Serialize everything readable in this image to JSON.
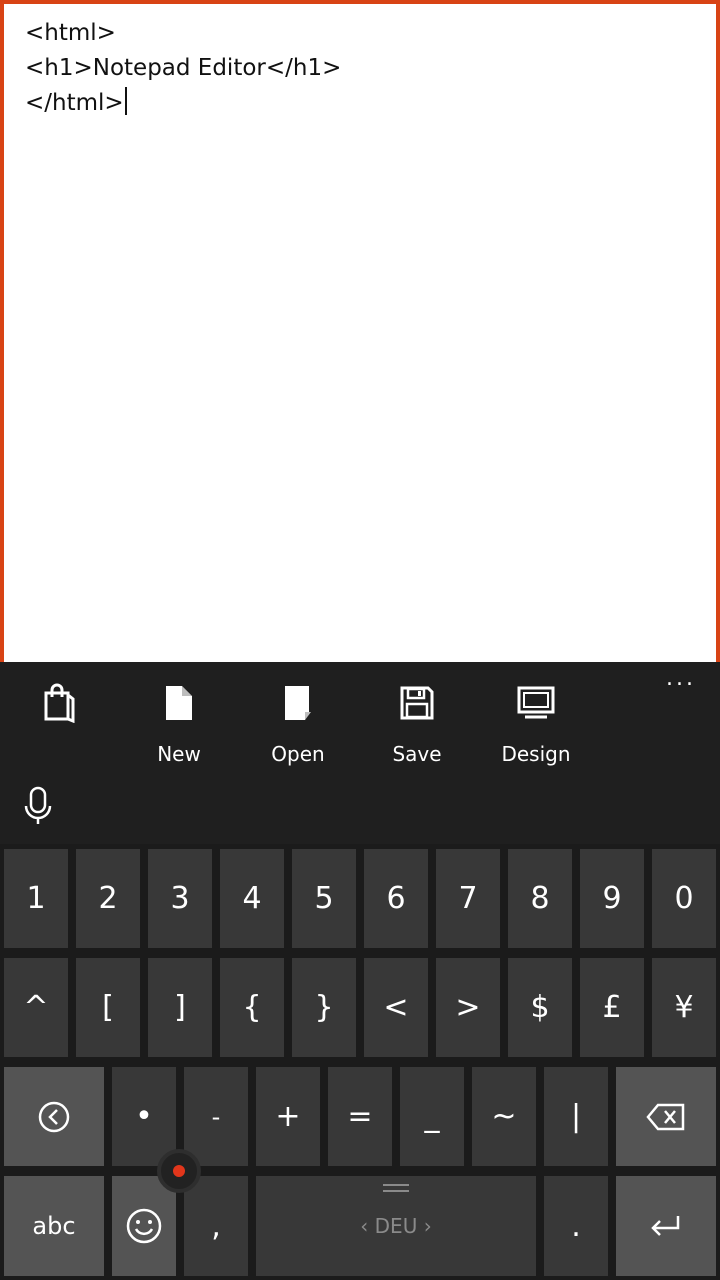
{
  "editor": {
    "lines": [
      "<html>",
      "<h1>Notepad Editor</h1>",
      "</html>"
    ]
  },
  "appbar": {
    "buttons": [
      {
        "icon": "store-bag-icon",
        "label": ""
      },
      {
        "icon": "new-file-icon",
        "label": "New"
      },
      {
        "icon": "open-file-icon",
        "label": "Open"
      },
      {
        "icon": "save-disk-icon",
        "label": "Save"
      },
      {
        "icon": "design-monitor-icon",
        "label": "Design"
      }
    ],
    "more": "..."
  },
  "keyboard": {
    "row1": [
      "1",
      "2",
      "3",
      "4",
      "5",
      "6",
      "7",
      "8",
      "9",
      "0"
    ],
    "row2": [
      "^",
      "[",
      "]",
      "{",
      "}",
      "<",
      ">",
      "$",
      "£",
      "¥"
    ],
    "row3": [
      "•",
      "-",
      "+",
      "=",
      "_",
      "~",
      "|"
    ],
    "abc_label": "abc",
    "comma": ",",
    "period": ".",
    "space_label": "DEU",
    "colors": {
      "key": "#383838",
      "function_key": "#545454",
      "accent": "#e2361b",
      "border": "#d84315"
    }
  }
}
